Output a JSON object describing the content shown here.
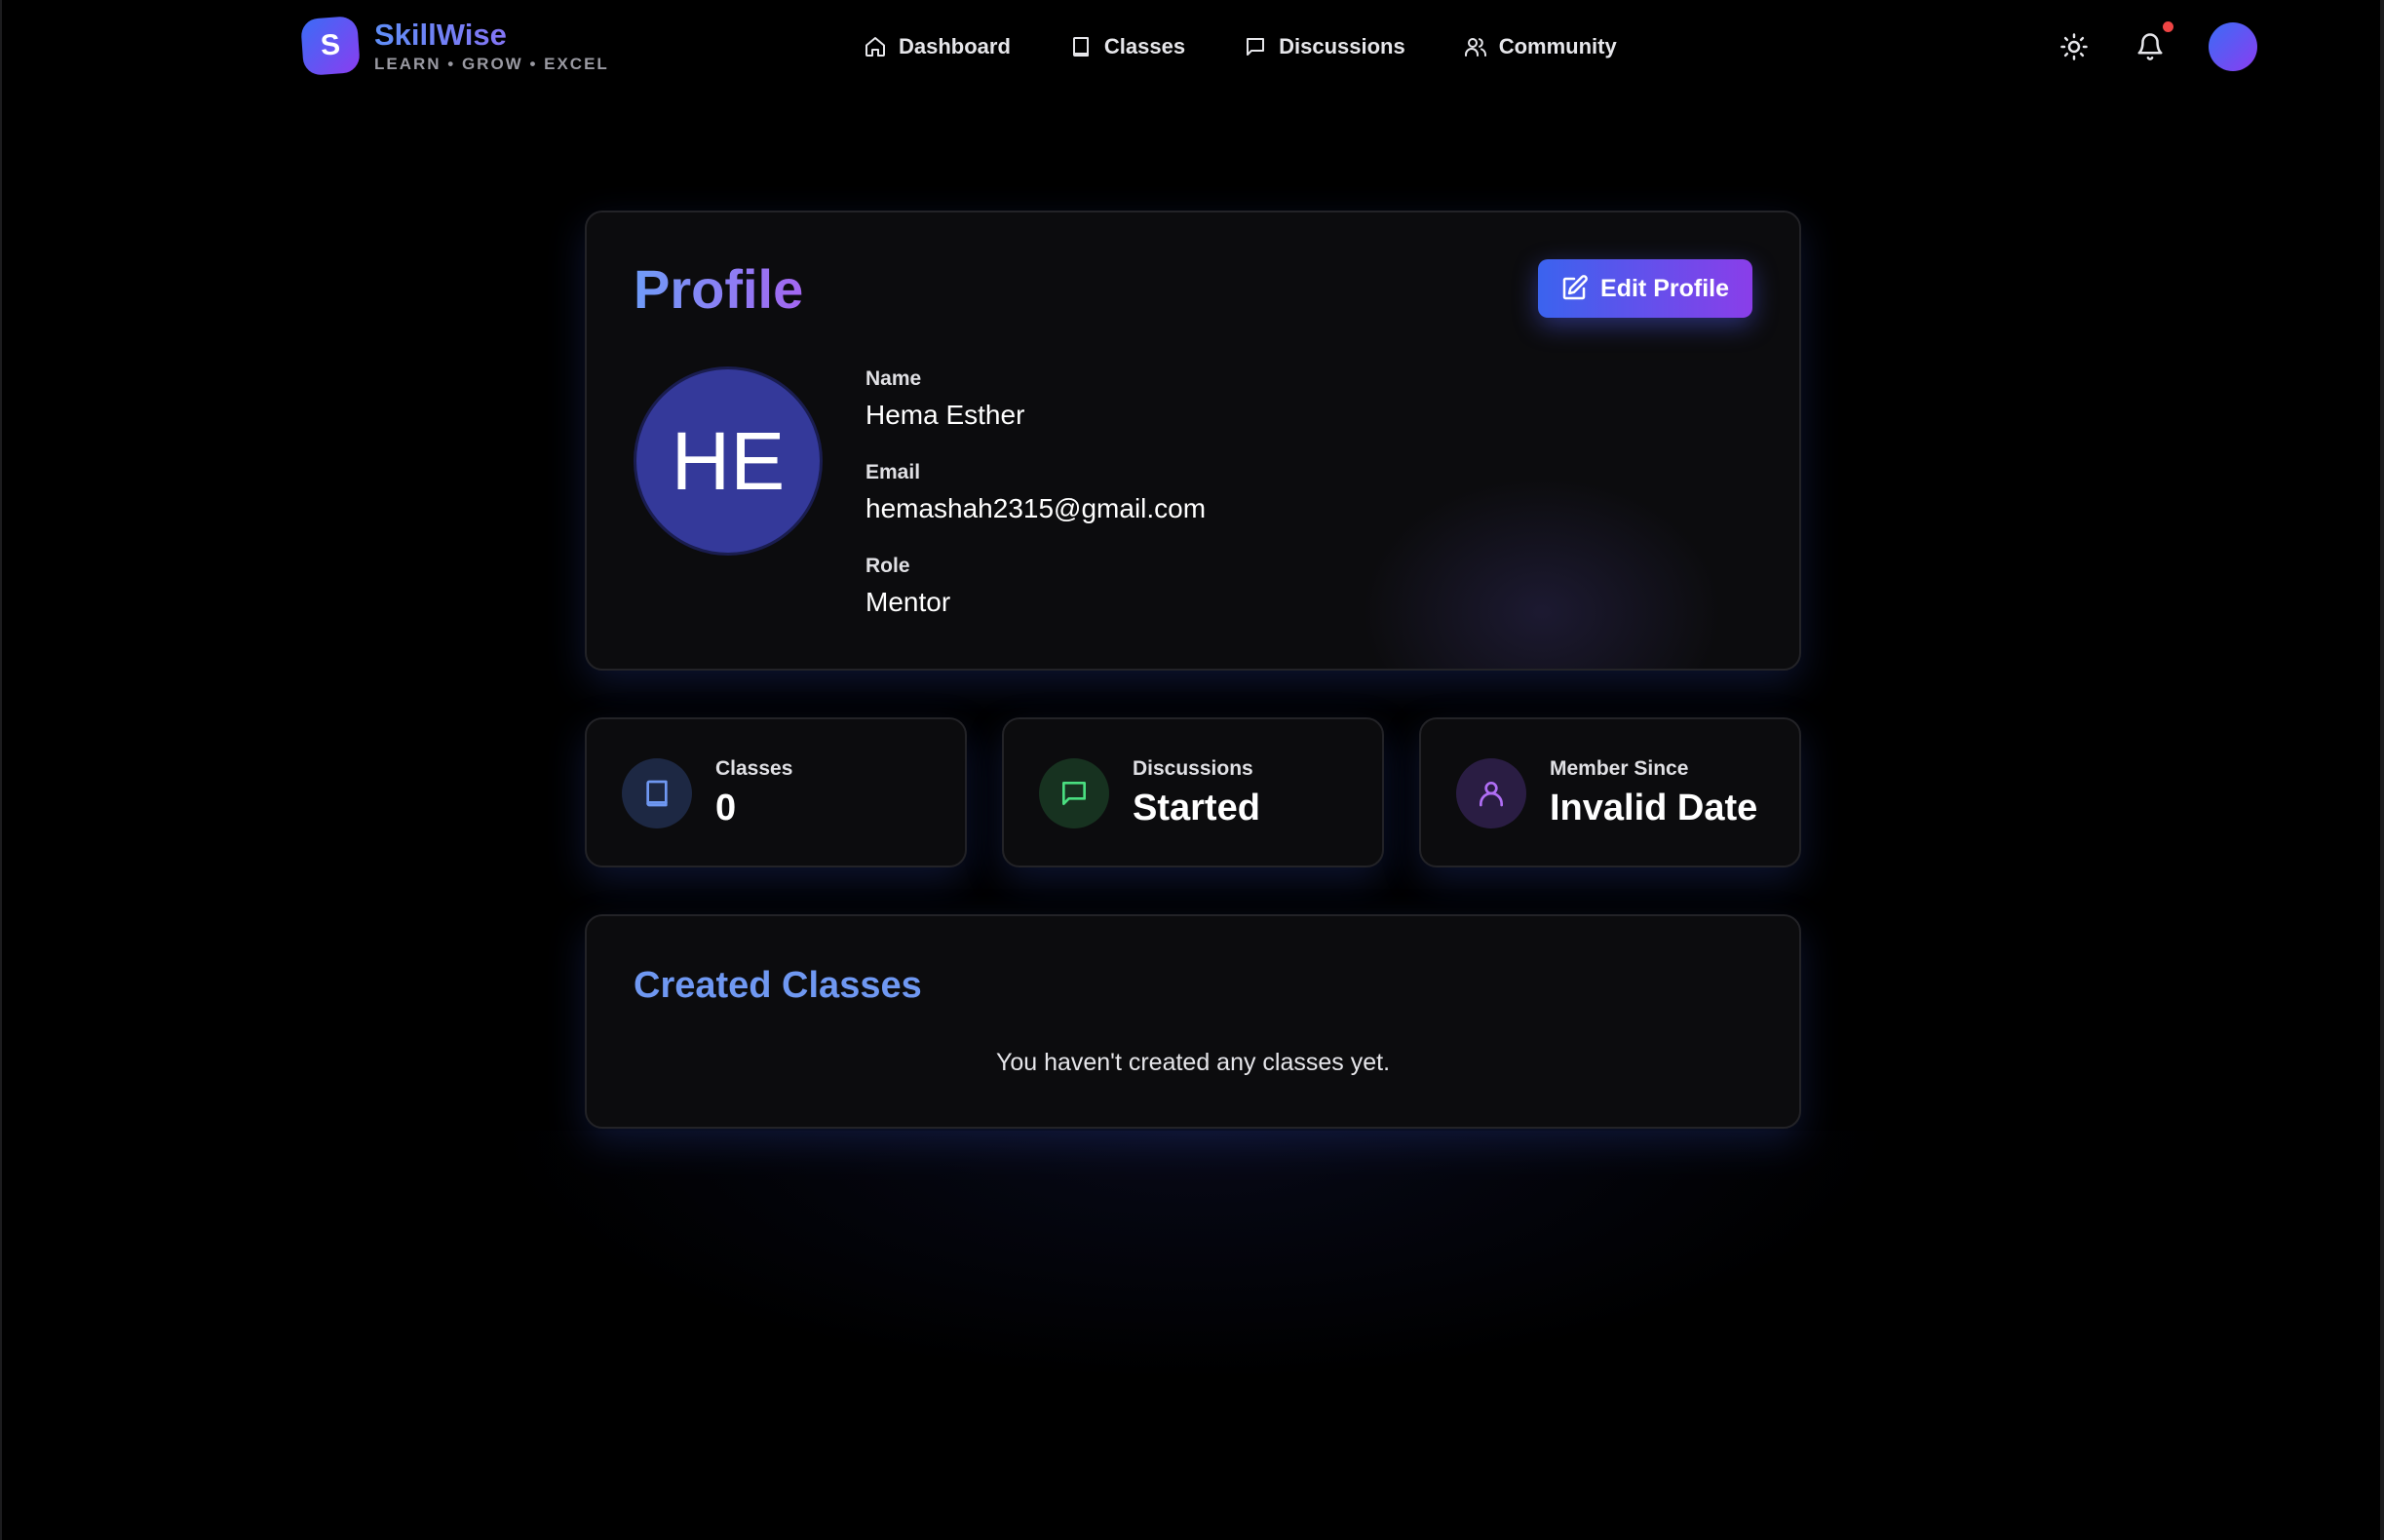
{
  "brand": {
    "logo_letter": "S",
    "name": "SkillWise",
    "tagline": "LEARN • GROW • EXCEL"
  },
  "nav": {
    "items": [
      {
        "label": "Dashboard",
        "icon": "home-icon"
      },
      {
        "label": "Classes",
        "icon": "book-icon"
      },
      {
        "label": "Discussions",
        "icon": "message-icon"
      },
      {
        "label": "Community",
        "icon": "users-icon"
      }
    ]
  },
  "header_actions": {
    "theme_icon": "sun-icon",
    "notifications_icon": "bell-icon",
    "notification_dot_color": "#ef4444"
  },
  "profile": {
    "title": "Profile",
    "edit_label": "Edit Profile",
    "initials": "HE",
    "fields": {
      "name_label": "Name",
      "name_value": "Hema Esther",
      "email_label": "Email",
      "email_value": "hemashah2315@gmail.com",
      "role_label": "Role",
      "role_value": "Mentor"
    }
  },
  "stats": [
    {
      "label": "Classes",
      "value": "0",
      "icon": "book-icon",
      "color": "#6f98f2"
    },
    {
      "label": "Discussions",
      "value": "Started",
      "icon": "message-icon",
      "color": "#4ade80"
    },
    {
      "label": "Member Since",
      "value": "Invalid Date",
      "icon": "user-icon",
      "color": "#b06ef5"
    }
  ],
  "created_classes": {
    "title": "Created Classes",
    "empty_message": "You haven't created any classes yet."
  },
  "colors": {
    "accent_blue": "#3b63ee",
    "accent_purple": "#8a3ee9",
    "background": "#000000",
    "card_bg": "#0c0c0e"
  }
}
